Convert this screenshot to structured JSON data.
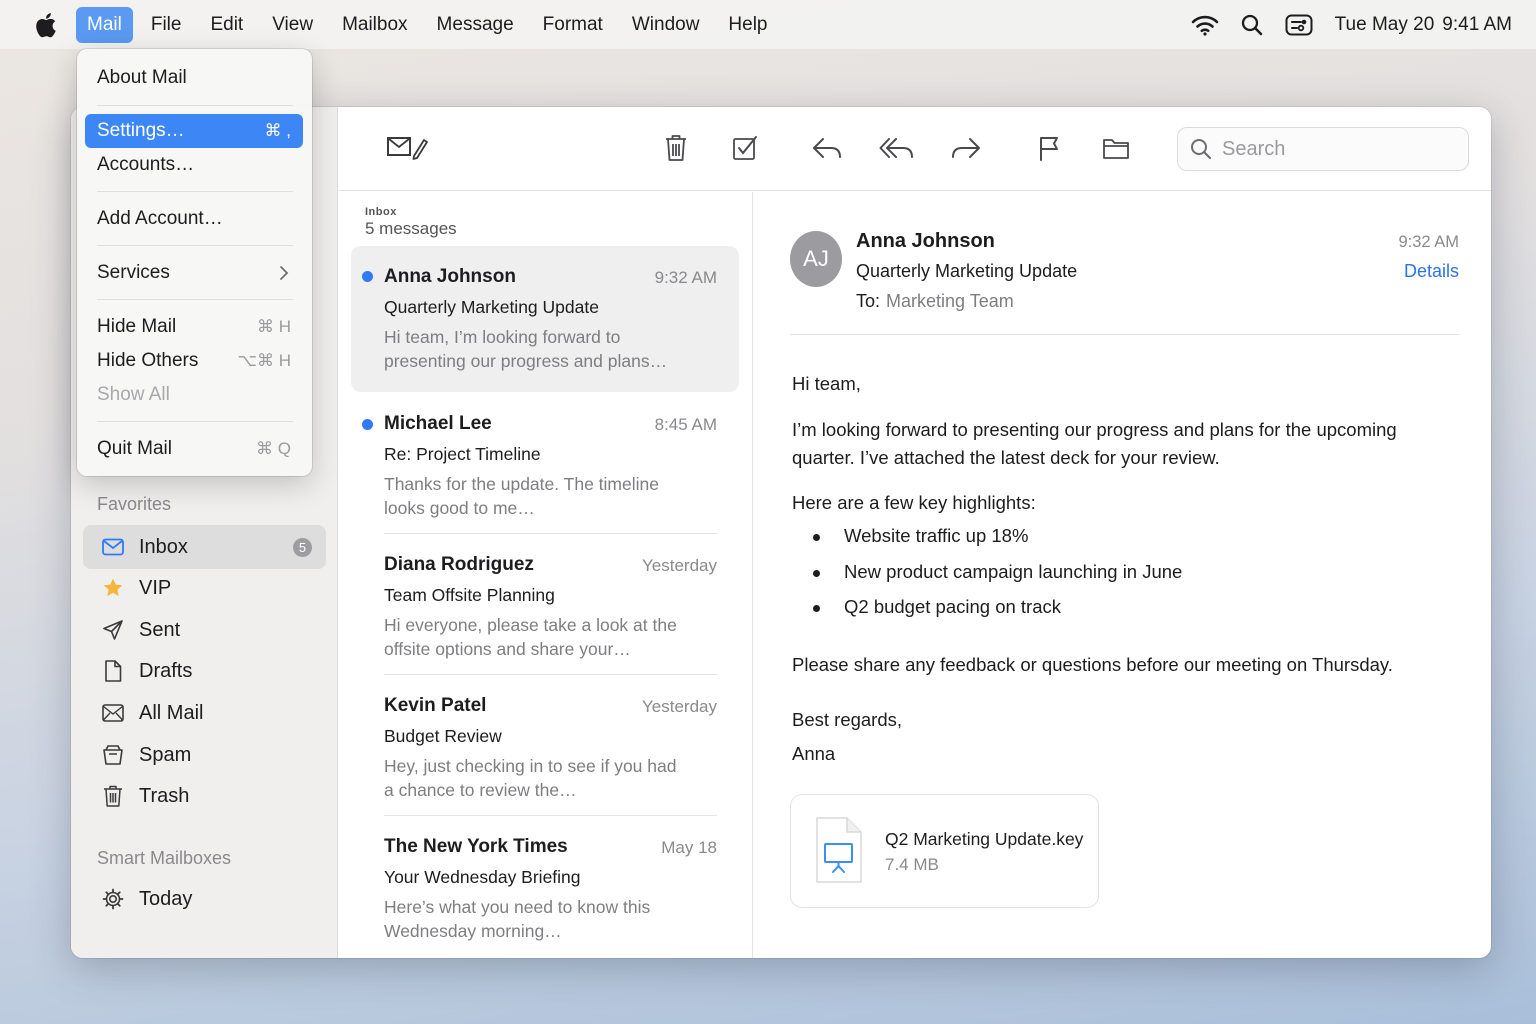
{
  "menubar": {
    "items": [
      "Mail",
      "File",
      "Edit",
      "View",
      "Mailbox",
      "Message",
      "Format",
      "Window",
      "Help"
    ],
    "active_index": 0,
    "date": "Tue May 20",
    "time": "9:41 AM"
  },
  "app_menu": {
    "about": "About Mail",
    "settings": "Settings…",
    "settings_shortcut": "⌘ ,",
    "accounts": "Accounts…",
    "add_account": "Add Account…",
    "services": "Services",
    "hide_mail": "Hide Mail",
    "hide_mail_shortcut": "⌘ H",
    "hide_others": "Hide Others",
    "hide_others_shortcut": "⌥⌘ H",
    "show_all": "Show All",
    "quit": "Quit Mail",
    "quit_shortcut": "⌘ Q"
  },
  "sidebar": {
    "favorites_label": "Favorites",
    "favorites": [
      {
        "label": "Inbox",
        "icon": "envelope-icon",
        "badge": "5"
      },
      {
        "label": "VIP",
        "icon": "star-icon"
      },
      {
        "label": "Sent",
        "icon": "paper-plane-icon"
      },
      {
        "label": "Drafts",
        "icon": "document-icon"
      },
      {
        "label": "All Mail",
        "icon": "tray-icon"
      },
      {
        "label": "Spam",
        "icon": "junk-icon"
      },
      {
        "label": "Trash",
        "icon": "trash-icon"
      }
    ],
    "smart_label": "Smart Mailboxes",
    "smart": [
      {
        "label": "Today",
        "icon": "gear-icon"
      }
    ]
  },
  "toolbar": {
    "search_placeholder": "Search"
  },
  "list": {
    "mailbox": "Inbox",
    "count": "5 messages",
    "messages": [
      {
        "from": "Anna Johnson",
        "time": "9:32 AM",
        "subject": "Quarterly Marketing Update",
        "preview": "Hi team, I’m looking forward to presenting our progress and plans…",
        "unread": true
      },
      {
        "from": "Michael Lee",
        "time": "8:45 AM",
        "subject": "Re: Project Timeline",
        "preview": "Thanks for the update. The timeline looks good to me…",
        "unread": true
      },
      {
        "from": "Diana Rodriguez",
        "time": "Yesterday",
        "subject": "Team Offsite Planning",
        "preview": "Hi everyone, please take a look at the offsite options and share your…",
        "unread": false
      },
      {
        "from": "Kevin Patel",
        "time": "Yesterday",
        "subject": "Budget Review",
        "preview": "Hey, just checking in to see if you had a chance to review the…",
        "unread": false
      },
      {
        "from": "The New York Times",
        "time": "May 18",
        "subject": "Your Wednesday Briefing",
        "preview": "Here’s what you need to know this Wednesday morning…",
        "unread": false
      }
    ]
  },
  "email": {
    "initials": "AJ",
    "from": "Anna Johnson",
    "subject": "Quarterly Marketing Update",
    "to_label": "To:",
    "to": "Marketing Team",
    "time": "9:32 AM",
    "details": "Details",
    "greeting": "Hi team,",
    "para1": "I’m looking forward to presenting our progress and plans for the upcoming quarter. I’ve attached the latest deck for your review.",
    "para2": "Here are a few key highlights:",
    "bullets": [
      "Website traffic up 18%",
      "New product campaign launching in June",
      "Q2 budget pacing on track"
    ],
    "para3": "Please share any feedback or questions before our meeting on Thursday.",
    "signoff": "Best regards,",
    "signature": "Anna",
    "attachment": {
      "name": "Q2 Marketing Update.key",
      "size": "7.4 MB"
    }
  },
  "colors": {
    "accent": "#3d86f5",
    "unread_dot": "#2f7bf5",
    "link": "#2a74e8"
  }
}
